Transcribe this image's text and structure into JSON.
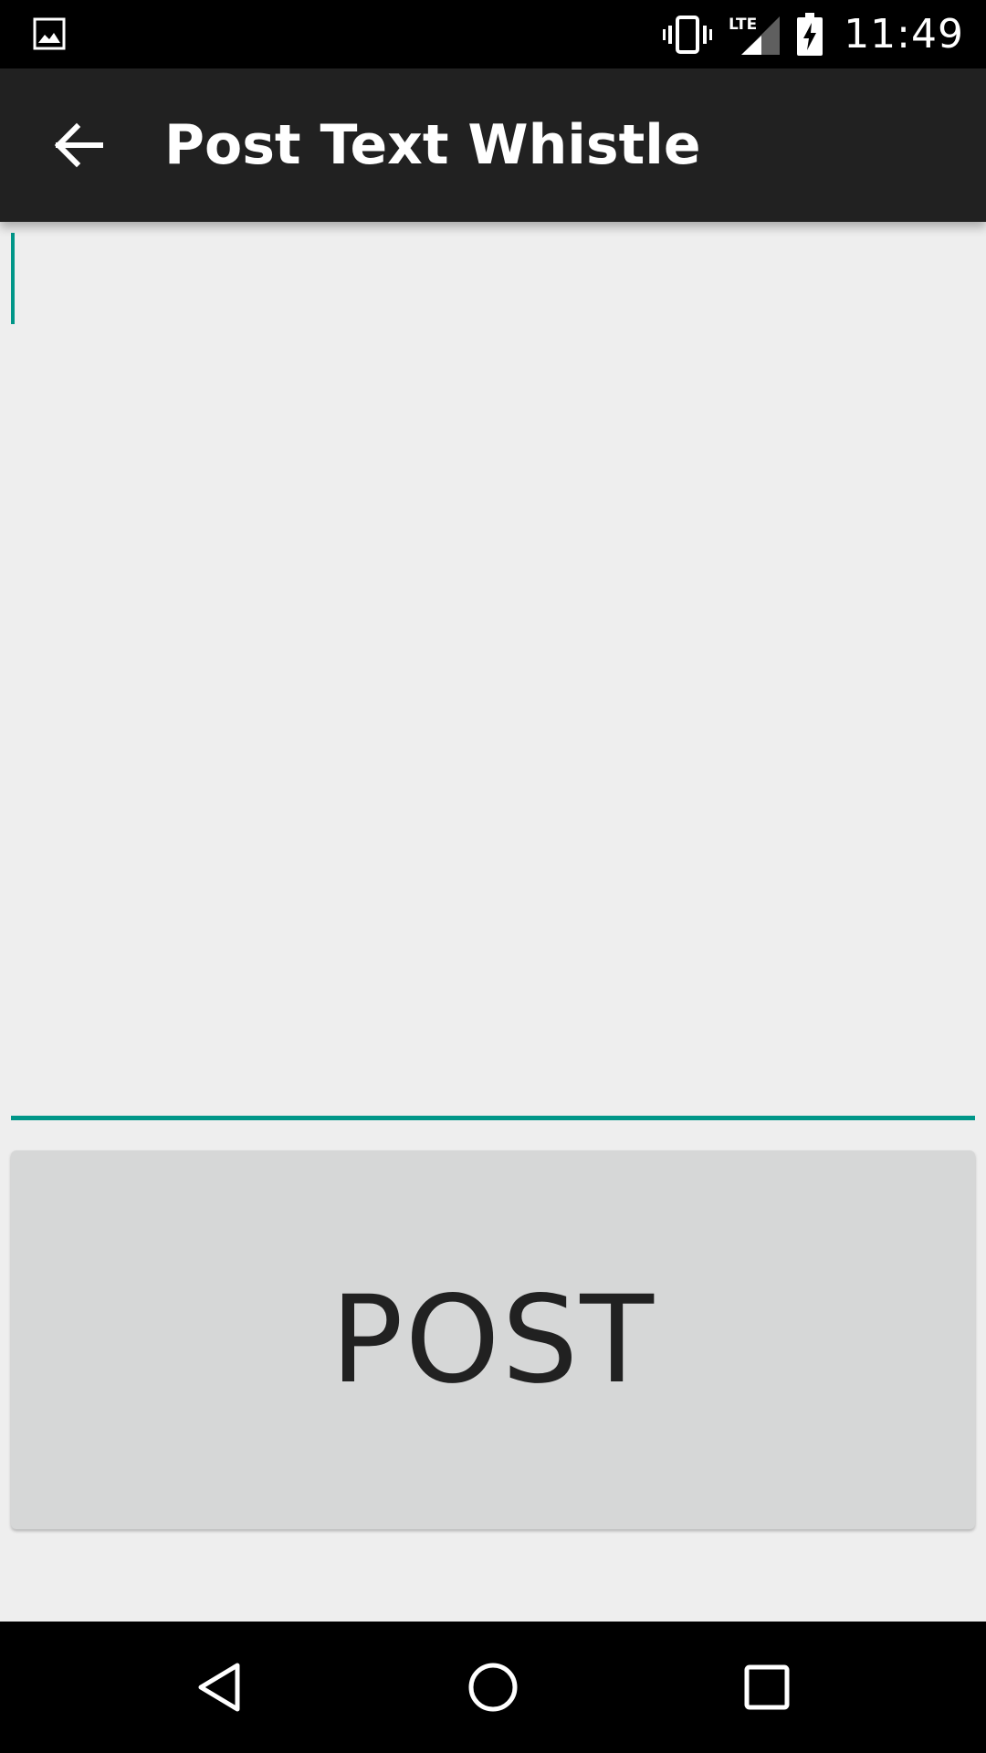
{
  "status_bar": {
    "time": "11:49",
    "network": "LTE",
    "icons": [
      "image-notification-icon",
      "vibrate-icon",
      "lte-signal-icon",
      "battery-charging-icon"
    ]
  },
  "app_bar": {
    "title": "Post Text Whistle",
    "back_icon": "arrow-back-icon"
  },
  "text_field": {
    "value": "",
    "accent_color": "#009688"
  },
  "post_button": {
    "label": "POST"
  },
  "nav_bar": {
    "icons": [
      "nav-back-icon",
      "nav-home-icon",
      "nav-recents-icon"
    ]
  }
}
